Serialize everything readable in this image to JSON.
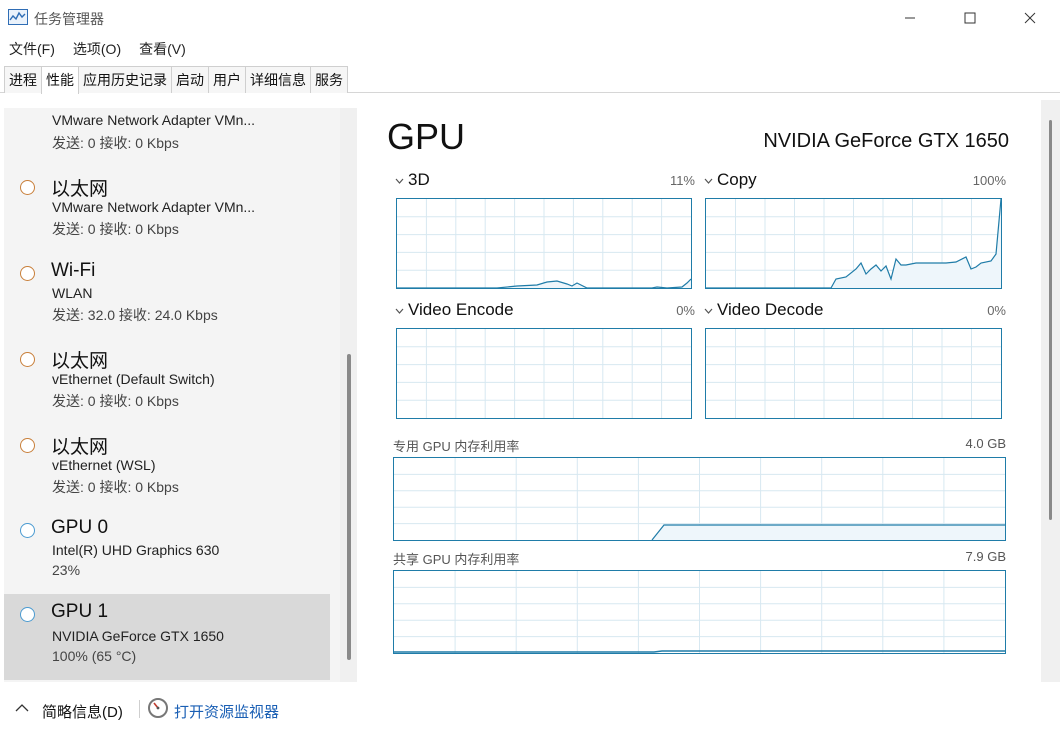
{
  "window": {
    "title": "任务管理器",
    "controls": [
      "minimize",
      "maximize",
      "close"
    ]
  },
  "menu": [
    {
      "label": "文件(F)"
    },
    {
      "label": "选项(O)"
    },
    {
      "label": "查看(V)"
    }
  ],
  "tabs": [
    {
      "label": "进程",
      "active": false
    },
    {
      "label": "性能",
      "active": true
    },
    {
      "label": "应用历史记录",
      "active": false
    },
    {
      "label": "启动",
      "active": false
    },
    {
      "label": "用户",
      "active": false
    },
    {
      "label": "详细信息",
      "active": false
    },
    {
      "label": "服务",
      "active": false
    }
  ],
  "devices": [
    {
      "name": "",
      "sub": "VMware Network Adapter VMn...",
      "stat": "发送: 0 接收: 0 Kbps",
      "kind": "net",
      "partial": true
    },
    {
      "name": "以太网",
      "sub": "VMware Network Adapter VMn...",
      "stat": "发送: 0 接收: 0 Kbps",
      "kind": "net"
    },
    {
      "name": "Wi-Fi",
      "sub": "WLAN",
      "stat": "发送: 32.0 接收: 24.0 Kbps",
      "kind": "net"
    },
    {
      "name": "以太网",
      "sub": "vEthernet (Default Switch)",
      "stat": "发送: 0 接收: 0 Kbps",
      "kind": "net"
    },
    {
      "name": "以太网",
      "sub": "vEthernet (WSL)",
      "stat": "发送: 0 接收: 0 Kbps",
      "kind": "net"
    },
    {
      "name": "GPU 0",
      "sub": "Intel(R) UHD Graphics 630",
      "stat": "23%",
      "kind": "gpu"
    },
    {
      "name": "GPU 1",
      "sub": "NVIDIA GeForce GTX 1650",
      "stat": "100% (65 °C)",
      "kind": "gpu",
      "selected": true
    }
  ],
  "gpu": {
    "heading": "GPU",
    "model": "NVIDIA GeForce GTX 1650",
    "engines": [
      {
        "label": "3D",
        "pct": "11%"
      },
      {
        "label": "Copy",
        "pct": "100%"
      },
      {
        "label": "Video Encode",
        "pct": "0%"
      },
      {
        "label": "Video Decode",
        "pct": "0%"
      }
    ],
    "dedicated": {
      "label": "专用 GPU 内存利用率",
      "max": "4.0 GB"
    },
    "shared": {
      "label": "共享 GPU 内存利用率",
      "max": "7.9 GB"
    }
  },
  "colors": {
    "net_circle": "#c87f3a",
    "gpu_circle": "#4b9bd1",
    "chart_line": "#1f7ca8",
    "chart_fill": "#eef6fb",
    "grid": "#d7e8f1"
  },
  "footer": {
    "fewer_details": "简略信息(D)",
    "open_monitor": "打开资源监视器"
  }
}
